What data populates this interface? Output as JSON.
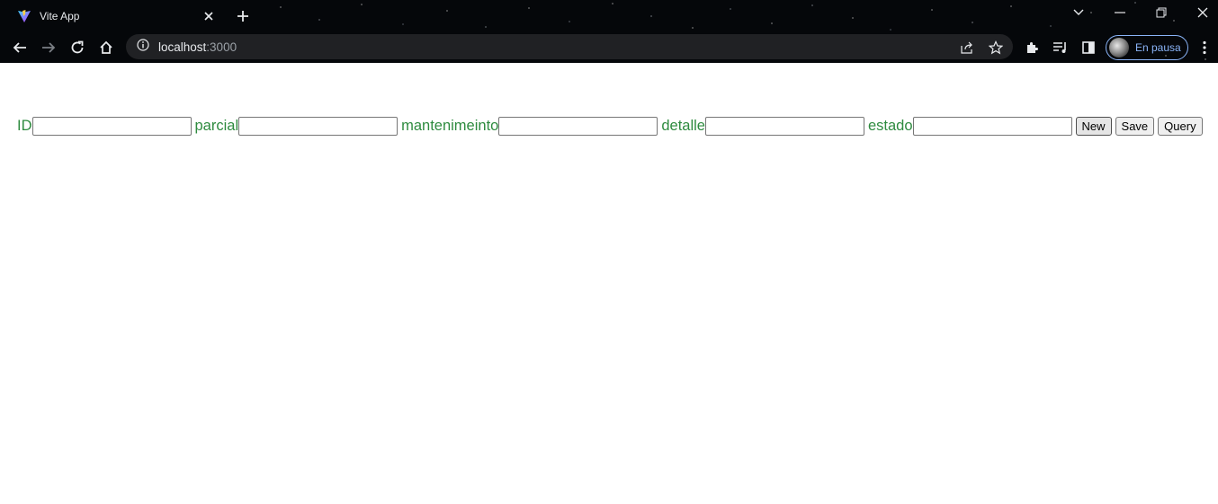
{
  "browser": {
    "tab_title": "Vite App",
    "url_host": "localhost",
    "url_port": ":3000",
    "profile_label": "En pausa"
  },
  "form": {
    "fields": [
      {
        "label": "ID",
        "value": ""
      },
      {
        "label": "parcial",
        "value": ""
      },
      {
        "label": "mantenimeinto",
        "value": ""
      },
      {
        "label": "detalle",
        "value": ""
      },
      {
        "label": "estado",
        "value": ""
      }
    ],
    "buttons": {
      "new_label": "New",
      "save_label": "Save",
      "query_label": "Query"
    }
  },
  "colors": {
    "label_green": "#2e8b3f",
    "chrome_dark": "#05070a",
    "accent_blue": "#8ab4f8"
  }
}
